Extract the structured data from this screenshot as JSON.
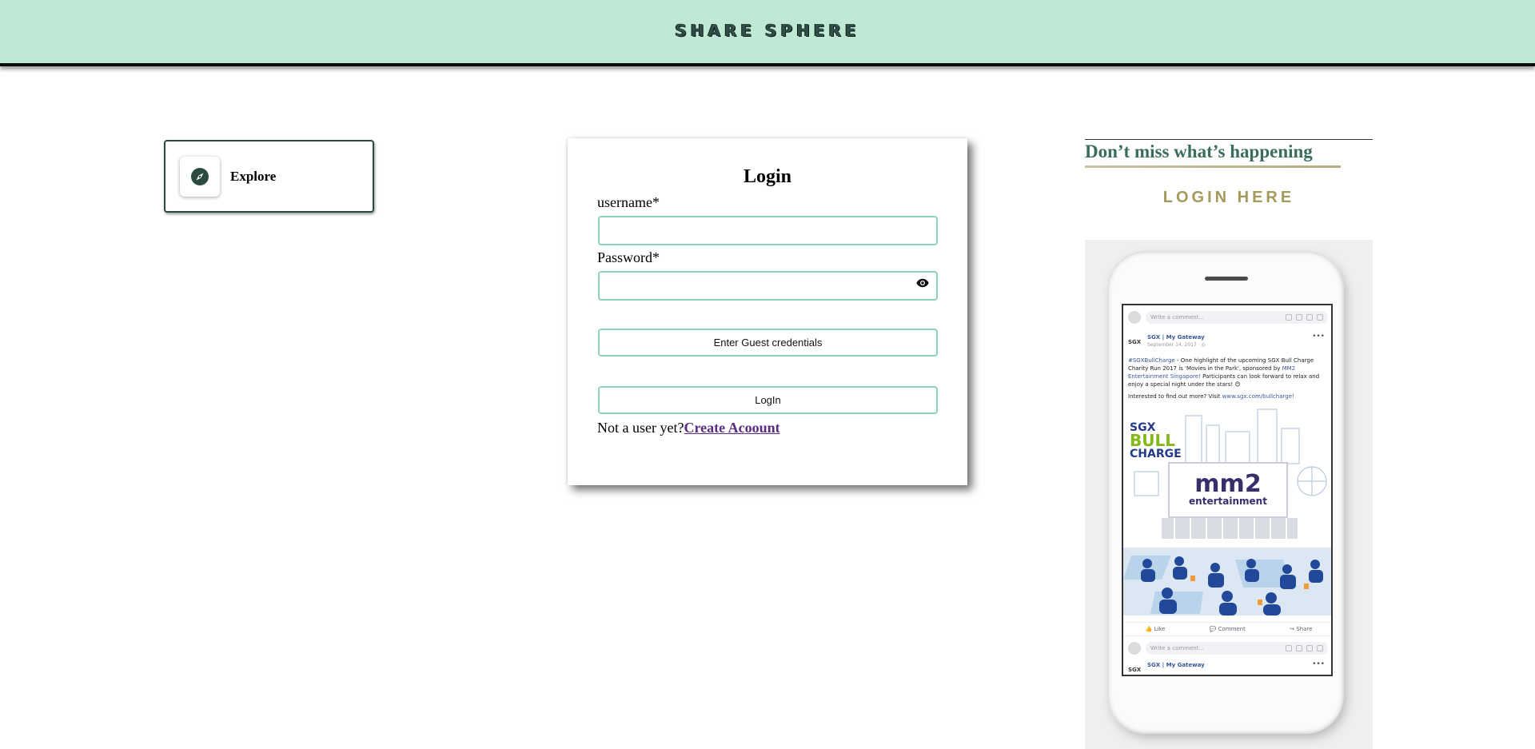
{
  "header": {
    "brand": "SHARE SPHERE"
  },
  "sidebar": {
    "explore_label": "Explore"
  },
  "login": {
    "title": "Login",
    "username_label": "username*",
    "username_value": "",
    "password_label": "Password*",
    "password_value": "",
    "guest_button": "Enter Guest credentials",
    "login_button": "LogIn",
    "signup_prompt": "Not a user yet?",
    "signup_link": "Create Acoount"
  },
  "right": {
    "headline": "Don’t miss what’s happening",
    "login_here": "LOGIN HERE"
  },
  "phone_preview": {
    "comment_placeholder": "Write a comment...",
    "post_logo": "SGX",
    "post_page": "SGX | My Gateway",
    "post_date": "September 14, 2017 · ◎",
    "post_hashtag": "#SGXBullCharge",
    "post_text_1": " - One highlight of the upcoming SGX Bull Charge Charity Run 2017 is 'Movies in the Park', sponsored by ",
    "post_sponsor": "MM2 Entertainment Singapore!",
    "post_text_2": " Participants can look forward to relax and enjoy a special night under the stars! 😊",
    "post_visit": "Interested to find out more? Visit ",
    "post_visit_link": "www.sgx.com/bullcharge!",
    "art_sgx": "SGX",
    "art_bull": "BULL",
    "art_charge": "CHARGE",
    "art_mm2": "mm2",
    "art_mm2_sub": "entertainment",
    "action_like": "Like",
    "action_comment": "Comment",
    "action_share": "Share",
    "comment_placeholder_2": "Write a comment...",
    "post2_page": "SGX | My Gateway"
  },
  "colors": {
    "header_bg": "#bfe9d5",
    "accent_border": "#8ed2b7",
    "headline": "#3b6e5a",
    "login_here": "#a39a5c",
    "link": "#5a2d82"
  },
  "icons": {
    "explore": "compass-icon",
    "password_toggle": "eye-icon"
  }
}
